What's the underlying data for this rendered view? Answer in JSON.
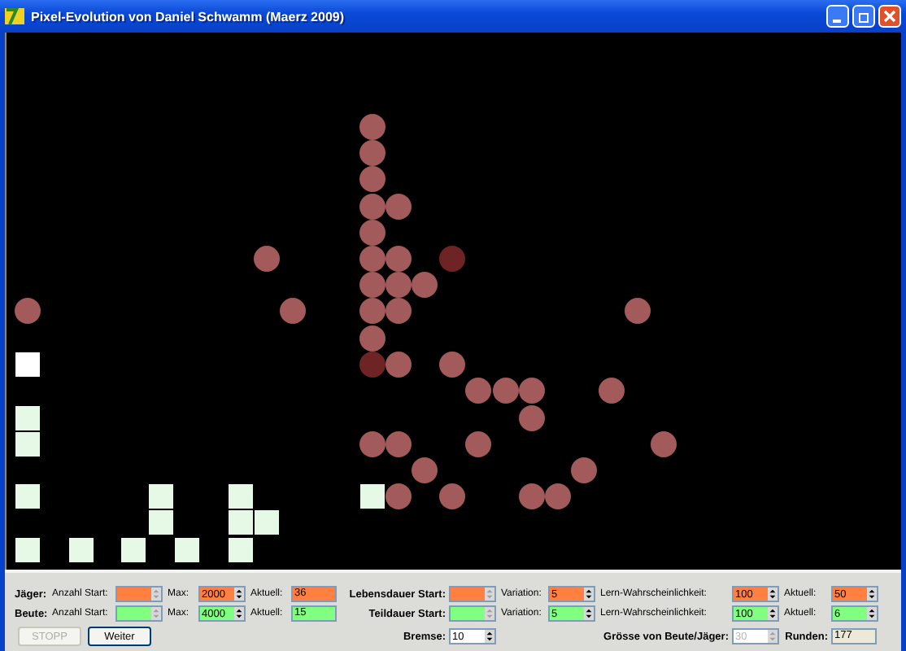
{
  "window": {
    "title": "Pixel-Evolution von Daniel Schwamm (Maerz 2009)"
  },
  "rows": [
    {
      "label": "Jäger:",
      "fields": [
        {
          "kind": "spinner",
          "label": "Anzahl Start:",
          "strong": false,
          "disabled": true,
          "color": "#ff8040"
        },
        {
          "kind": "spinner",
          "label": "Max:",
          "strong": false,
          "value": "2000",
          "disabled": false,
          "color": "#ff8040"
        },
        {
          "kind": "readout",
          "label": "Aktuell:",
          "strong": false,
          "value": "36",
          "color": "#ff8040"
        },
        {
          "kind": "spinner",
          "label": "Lebensdauer Start:",
          "strong": true,
          "disabled": true,
          "color": "#ff8040"
        },
        {
          "kind": "spinner",
          "label": "Variation:",
          "strong": false,
          "value": "5",
          "disabled": false,
          "color": "#ff8040"
        },
        {
          "kind": "spinner",
          "label": "Lern-Wahrscheinlichkeit:",
          "strong": false,
          "value": "100",
          "disabled": false,
          "color": "#ff8040"
        },
        {
          "kind": "spinner",
          "label": "Aktuell:",
          "strong": false,
          "value": "50",
          "disabled": false,
          "color": "#ff8040"
        }
      ]
    },
    {
      "label": "Beute:",
      "fields": [
        {
          "kind": "spinner",
          "label": "Anzahl Start:",
          "strong": false,
          "disabled": true,
          "color": "#80ff80"
        },
        {
          "kind": "spinner",
          "label": "Max:",
          "strong": false,
          "value": "4000",
          "disabled": false,
          "color": "#80ff80"
        },
        {
          "kind": "readout",
          "label": "Aktuell:",
          "strong": false,
          "value": "15",
          "color": "#80ff80"
        },
        {
          "kind": "spinner",
          "label": "Teildauer Start:",
          "strong": true,
          "disabled": true,
          "color": "#80ff80"
        },
        {
          "kind": "spinner",
          "label": "Variation:",
          "strong": false,
          "value": "5",
          "disabled": false,
          "color": "#80ff80"
        },
        {
          "kind": "spinner",
          "label": "Lern-Wahrscheinlichkeit:",
          "strong": false,
          "value": "100",
          "disabled": false,
          "color": "#80ff80"
        },
        {
          "kind": "spinner",
          "label": "Aktuell:",
          "strong": false,
          "value": "6",
          "disabled": false,
          "color": "#80ff80"
        }
      ]
    }
  ],
  "buttons": [
    {
      "label": "STOPP",
      "disabled": true
    },
    {
      "label": "Weiter",
      "disabled": false
    }
  ],
  "settings": [
    {
      "kind": "spinner",
      "label": "Bremse:",
      "strong": true,
      "value": "10",
      "disabled": false,
      "color": "#ffffff"
    },
    {
      "kind": "spinner",
      "label": "Grösse von Beute/Jäger:",
      "strong": true,
      "value": "30",
      "disabled": true,
      "color": "#ffffff"
    },
    {
      "kind": "readout",
      "label": "Runden:",
      "strong": true,
      "value": "177",
      "color": "#ece9d8"
    }
  ]
}
